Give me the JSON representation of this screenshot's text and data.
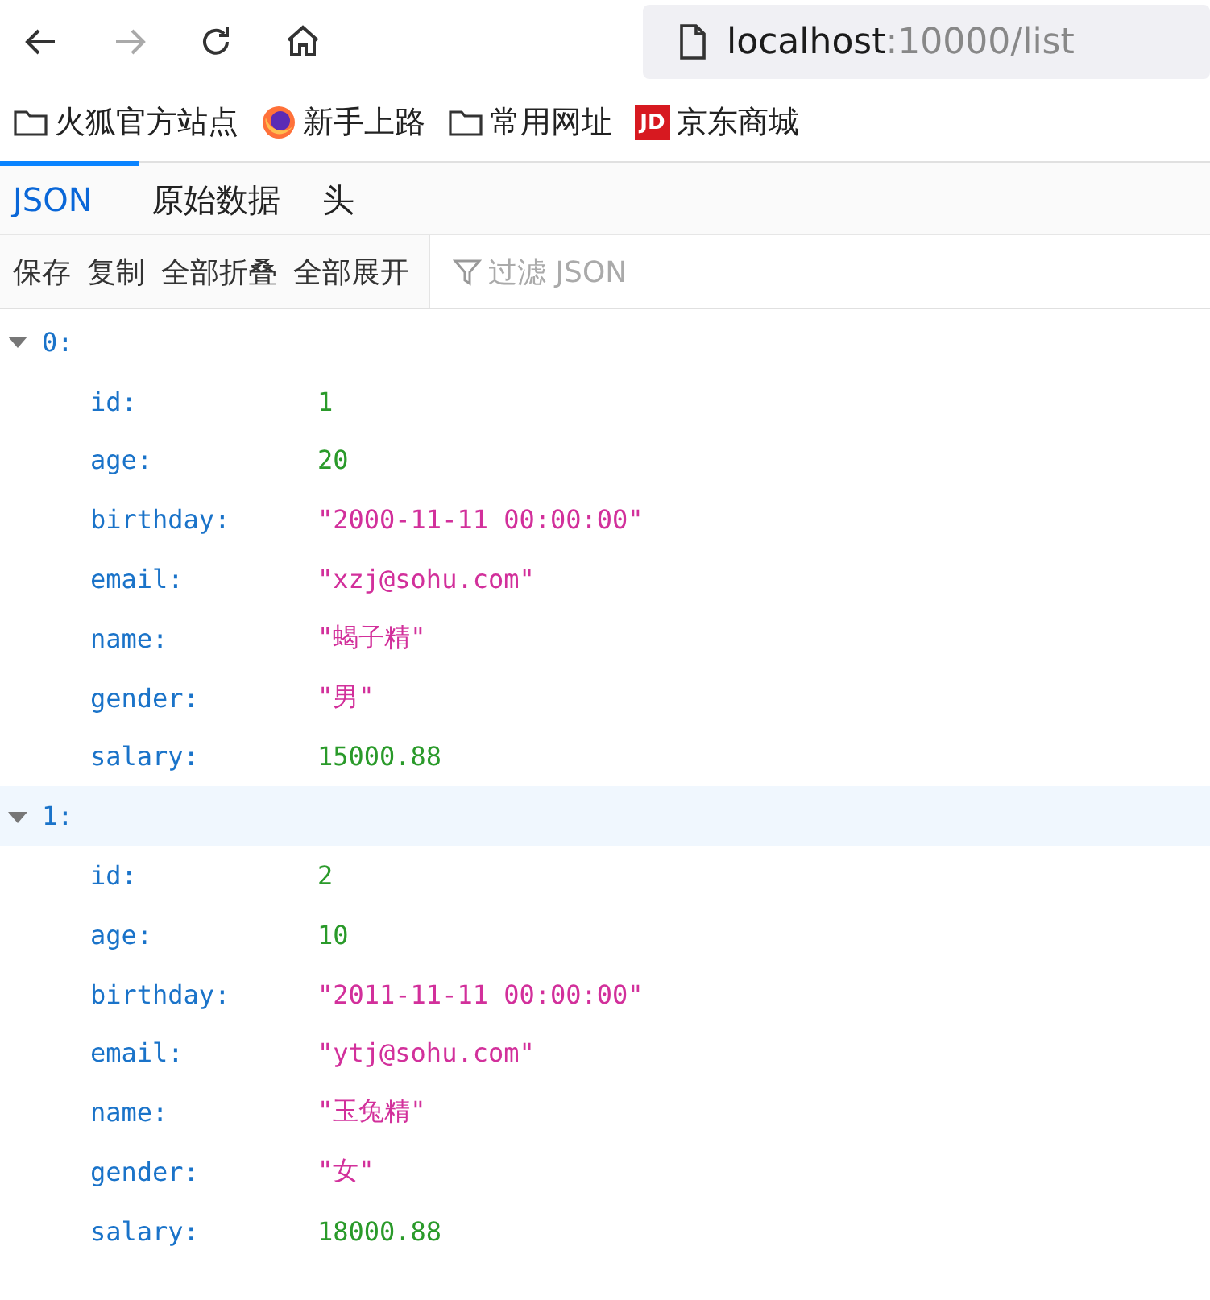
{
  "address_bar": {
    "host": "localhost",
    "path": ":10000/list"
  },
  "bookmarks": [
    {
      "kind": "folder",
      "label": "火狐官方站点"
    },
    {
      "kind": "firefox",
      "label": "新手上路"
    },
    {
      "kind": "folder",
      "label": "常用网址"
    },
    {
      "kind": "jd",
      "label": "京东商城",
      "badge": "JD"
    }
  ],
  "tabs": [
    {
      "label": "JSON",
      "selected": true
    },
    {
      "label": "原始数据",
      "selected": false
    },
    {
      "label": "头",
      "selected": false
    }
  ],
  "toolbar": {
    "buttons": [
      "保存",
      "复制",
      "全部折叠",
      "全部展开"
    ],
    "filter": {
      "placeholder": "过滤 JSON"
    }
  },
  "tree": [
    {
      "key": "0:",
      "expanded": true,
      "highlighted": false,
      "children": [
        {
          "key": "id:",
          "value": "1",
          "kind": "number"
        },
        {
          "key": "age:",
          "value": "20",
          "kind": "number"
        },
        {
          "key": "birthday:",
          "value": "\"2000-11-11 00:00:00\"",
          "kind": "string"
        },
        {
          "key": "email:",
          "value": "\"xzj@sohu.com\"",
          "kind": "string"
        },
        {
          "key": "name:",
          "value": "\"蝎子精\"",
          "kind": "string"
        },
        {
          "key": "gender:",
          "value": "\"男\"",
          "kind": "string"
        },
        {
          "key": "salary:",
          "value": "15000.88",
          "kind": "number"
        }
      ]
    },
    {
      "key": "1:",
      "expanded": true,
      "highlighted": true,
      "children": [
        {
          "key": "id:",
          "value": "2",
          "kind": "number"
        },
        {
          "key": "age:",
          "value": "10",
          "kind": "number"
        },
        {
          "key": "birthday:",
          "value": "\"2011-11-11 00:00:00\"",
          "kind": "string"
        },
        {
          "key": "email:",
          "value": "\"ytj@sohu.com\"",
          "kind": "string"
        },
        {
          "key": "name:",
          "value": "\"玉兔精\"",
          "kind": "string"
        },
        {
          "key": "gender:",
          "value": "\"女\"",
          "kind": "string"
        },
        {
          "key": "salary:",
          "value": "18000.88",
          "kind": "number"
        }
      ]
    }
  ]
}
